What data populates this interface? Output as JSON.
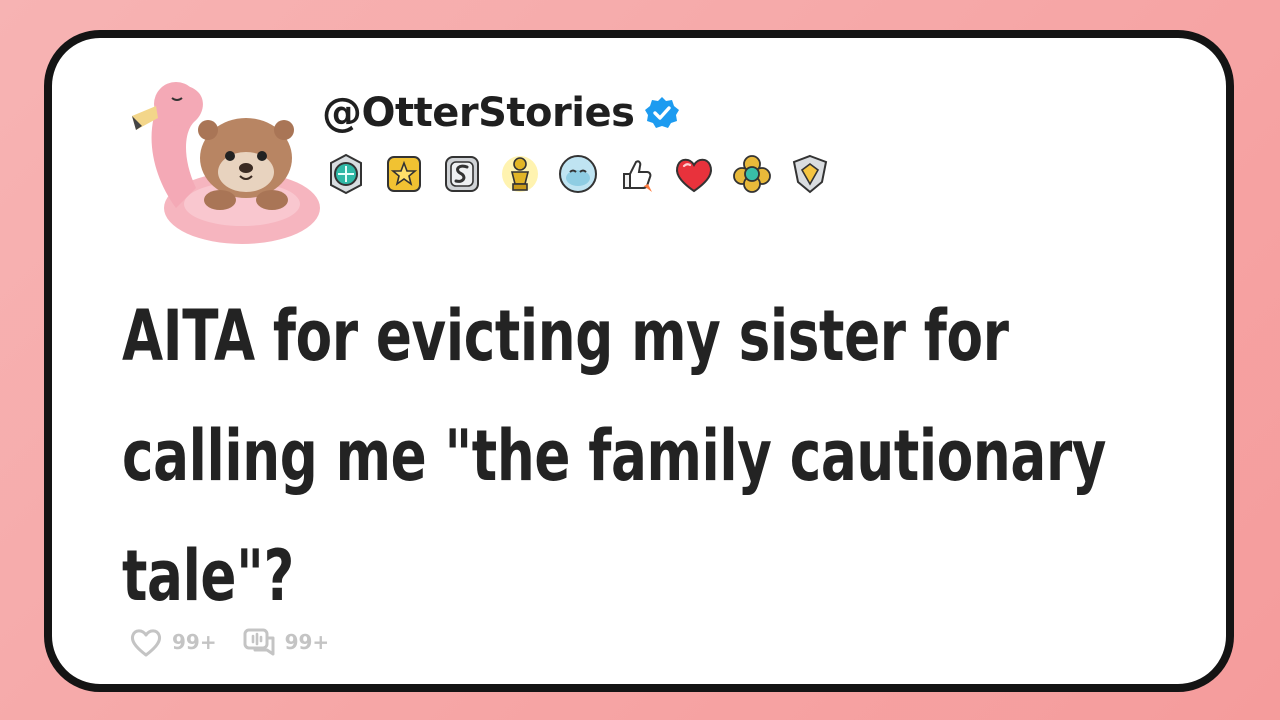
{
  "post": {
    "handle": "@OtterStories",
    "avatar_icon": "otter-on-flamingo-float-icon",
    "verified_icon": "verified-check-icon",
    "badges": [
      "teal-gem-award-icon",
      "gold-star-award-icon",
      "silver-s-award-icon",
      "gold-trophy-figure-award-icon",
      "blue-face-award-icon",
      "thumbs-up-rocket-award-icon",
      "red-heart-award-icon",
      "gold-clover-award-icon",
      "silver-shield-award-icon"
    ],
    "title": "AITA for evicting my sister for calling me \"the family cautionary tale\"?",
    "likes": "99+",
    "comments": "99+",
    "accent_color": "#1d9bf0",
    "background_color": "#f6a6a6"
  }
}
